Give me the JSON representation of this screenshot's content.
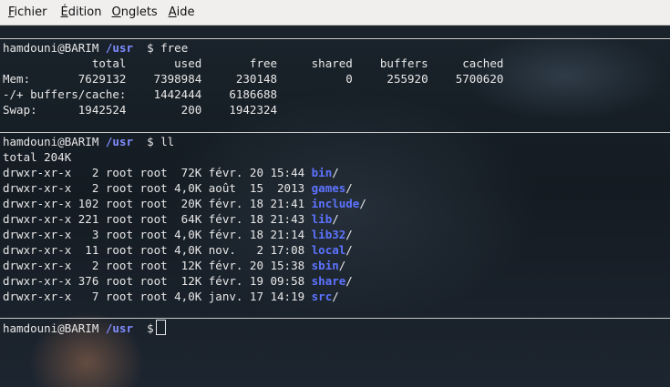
{
  "menubar": {
    "items": [
      {
        "underline": "F",
        "rest": "ichier"
      },
      {
        "underline": "É",
        "rest": "dition"
      },
      {
        "underline": "O",
        "rest": "nglets"
      },
      {
        "underline": "A",
        "rest": "ide"
      }
    ]
  },
  "terminal": {
    "prompt": {
      "user_host": "hamdouni@BARIM",
      "path": "/usr",
      "symbol": "$"
    },
    "free_block": {
      "command": "free",
      "header": "             total       used       free     shared    buffers     cached",
      "rows": [
        "Mem:       7629132    7398984     230148          0     255920    5700620",
        "-/+ buffers/cache:    1442444    6186688",
        "Swap:      1942524        200    1942324"
      ]
    },
    "ll_block": {
      "command": "ll",
      "total": "total 204K",
      "entries": [
        {
          "meta": "drwxr-xr-x   2 root root  72K févr. 20 15:44 ",
          "name": "bin",
          "suffix": "/"
        },
        {
          "meta": "drwxr-xr-x   2 root root 4,0K août  15  2013 ",
          "name": "games",
          "suffix": "/"
        },
        {
          "meta": "drwxr-xr-x 102 root root  20K févr. 18 21:41 ",
          "name": "include",
          "suffix": "/"
        },
        {
          "meta": "drwxr-xr-x 221 root root  64K févr. 18 21:43 ",
          "name": "lib",
          "suffix": "/"
        },
        {
          "meta": "drwxr-xr-x   3 root root 4,0K févr. 18 21:14 ",
          "name": "lib32",
          "suffix": "/"
        },
        {
          "meta": "drwxr-xr-x  11 root root 4,0K nov.   2 17:08 ",
          "name": "local",
          "suffix": "/"
        },
        {
          "meta": "drwxr-xr-x   2 root root  12K févr. 20 15:38 ",
          "name": "sbin",
          "suffix": "/"
        },
        {
          "meta": "drwxr-xr-x 376 root root  12K févr. 19 09:58 ",
          "name": "share",
          "suffix": "/"
        },
        {
          "meta": "drwxr-xr-x   7 root root 4,0K janv. 17 14:19 ",
          "name": "src",
          "suffix": "/"
        }
      ]
    },
    "colors": {
      "path": "#7f8cff",
      "directory": "#5d73ff",
      "text": "#e8e8e8"
    }
  }
}
